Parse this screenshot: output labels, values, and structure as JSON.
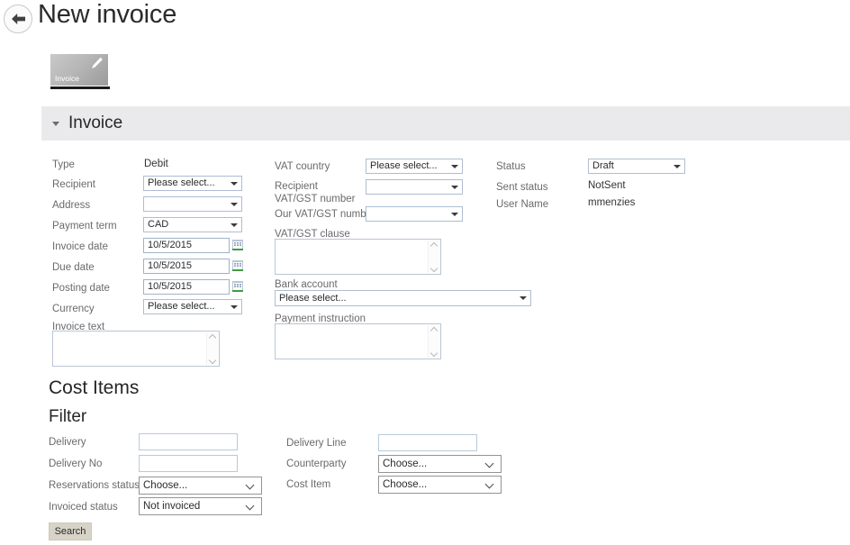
{
  "header": {
    "title": "New invoice",
    "back_icon": "back-arrow-icon"
  },
  "tile": {
    "label": "Invoice",
    "icon": "pencil-edit-icon"
  },
  "section": {
    "title": "Invoice",
    "caret_icon": "caret-down-icon"
  },
  "invoice_form": {
    "left_column": {
      "type_label": "Type",
      "type_value": "Debit",
      "recipient_label": "Recipient",
      "recipient_value": "Please select...",
      "address_label": "Address",
      "address_value": "",
      "payment_term_label": "Payment term",
      "payment_term_value": "CAD",
      "invoice_date_label": "Invoice date",
      "invoice_date_value": "10/5/2015",
      "due_date_label": "Due date",
      "due_date_value": "10/5/2015",
      "posting_date_label": "Posting date",
      "posting_date_value": "10/5/2015",
      "currency_label": "Currency",
      "currency_value": "Please select...",
      "invoice_text_label": "Invoice text",
      "invoice_text_value": "",
      "calendar_icon": "calendar-icon"
    },
    "middle_column": {
      "vat_country_label": "VAT country",
      "vat_country_value": "Please select...",
      "recipient_vat_label": "Recipient VAT/GST number",
      "recipient_vat_value": "",
      "our_vat_label": "Our VAT/GST number",
      "our_vat_value": "",
      "vat_clause_label": "VAT/GST clause",
      "vat_clause_value": "",
      "bank_account_label": "Bank account",
      "bank_account_value": "Please select...",
      "payment_instruction_label": "Payment instruction",
      "payment_instruction_value": ""
    },
    "right_column": {
      "status_label": "Status",
      "status_value": "Draft",
      "sent_status_label": "Sent status",
      "sent_status_value": "NotSent",
      "user_name_label": "User Name",
      "user_name_value": "mmenzies"
    }
  },
  "cost_items": {
    "heading": "Cost Items",
    "filter_heading": "Filter",
    "left": {
      "delivery_label": "Delivery",
      "delivery_value": "",
      "delivery_no_label": "Delivery No",
      "delivery_no_value": "",
      "reservations_status_label": "Reservations status",
      "reservations_status_value": "Choose...",
      "invoiced_status_label": "Invoiced status",
      "invoiced_status_value": "Not invoiced"
    },
    "right": {
      "delivery_line_label": "Delivery Line",
      "delivery_line_value": "",
      "counterparty_label": "Counterparty",
      "counterparty_value": "Choose...",
      "cost_item_label": "Cost Item",
      "cost_item_value": "Choose..."
    },
    "search_label": "Search"
  },
  "colors": {
    "section_bar": "#eaeaec",
    "tile_gradient_start": "#c9c9c9",
    "tile_gradient_end": "#9b9b9b",
    "search_button": "#d7d3c6",
    "field_border": "#aebed2",
    "label_text": "#6a6a6a"
  }
}
